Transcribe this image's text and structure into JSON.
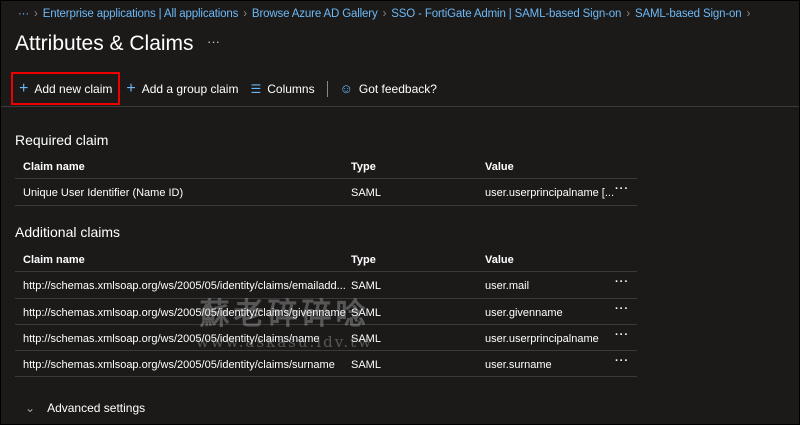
{
  "breadcrumb": {
    "more": "···",
    "items": [
      "Enterprise applications | All applications",
      "Browse Azure AD Gallery",
      "SSO - FortiGate Admin | SAML-based Sign-on",
      "SAML-based Sign-on"
    ]
  },
  "page": {
    "title": "Attributes & Claims",
    "more": "···"
  },
  "toolbar": {
    "add_new_claim": "Add new claim",
    "add_group_claim": "Add a group claim",
    "columns": "Columns",
    "feedback": "Got feedback?"
  },
  "required": {
    "title": "Required claim",
    "headers": [
      "Claim name",
      "Type",
      "Value"
    ],
    "rows": [
      {
        "name": "Unique User Identifier (Name ID)",
        "type": "SAML",
        "value": "user.userprincipalname [..."
      }
    ]
  },
  "additional": {
    "title": "Additional claims",
    "headers": [
      "Claim name",
      "Type",
      "Value"
    ],
    "rows": [
      {
        "name": "http://schemas.xmlsoap.org/ws/2005/05/identity/claims/emailadd...",
        "type": "SAML",
        "value": "user.mail"
      },
      {
        "name": "http://schemas.xmlsoap.org/ws/2005/05/identity/claims/givenname",
        "type": "SAML",
        "value": "user.givenname"
      },
      {
        "name": "http://schemas.xmlsoap.org/ws/2005/05/identity/claims/name",
        "type": "SAML",
        "value": "user.userprincipalname"
      },
      {
        "name": "http://schemas.xmlsoap.org/ws/2005/05/identity/claims/surname",
        "type": "SAML",
        "value": "user.surname"
      }
    ]
  },
  "row_more": "···",
  "advanced": "Advanced settings",
  "watermark": {
    "line1": "蘇老碎碎唸",
    "line2": "www.askasu.idv.tw"
  }
}
